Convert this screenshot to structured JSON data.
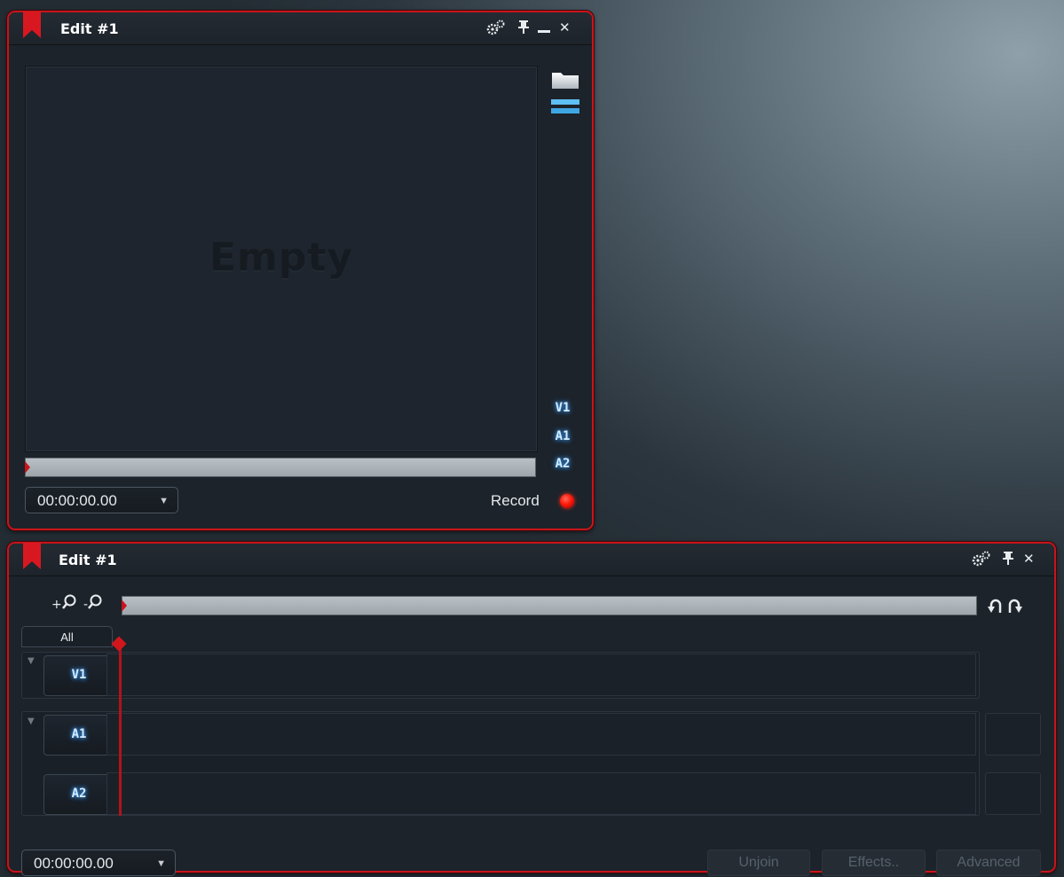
{
  "colors": {
    "accent_red": "#c8141a",
    "track_glow": "#3fa2ff",
    "panel_bg": "#1d232a"
  },
  "viewer": {
    "title": "Edit #1",
    "icons": [
      "gears-icon",
      "pin-icon",
      "minimize-icon",
      "close-icon",
      "folder-icon",
      "layers-icon"
    ],
    "empty_label": "Empty",
    "tracks": [
      "V1",
      "A1",
      "A2"
    ],
    "progress": 0,
    "timecode": "00:00:00.00",
    "record_label": "Record"
  },
  "timeline": {
    "title": "Edit #1",
    "icons": [
      "gears-icon",
      "pin-icon",
      "close-icon",
      "zoom-in-icon",
      "zoom-out-icon",
      "undo-icon",
      "redo-icon"
    ],
    "zoom_in": "+",
    "zoom_out": "-",
    "all_tab": "All",
    "tracks": [
      "V1",
      "A1",
      "A2"
    ],
    "timecode": "00:00:00.00",
    "buttons": {
      "unjoin": "Unjoin",
      "effects": "Effects..",
      "advanced": "Advanced"
    }
  }
}
